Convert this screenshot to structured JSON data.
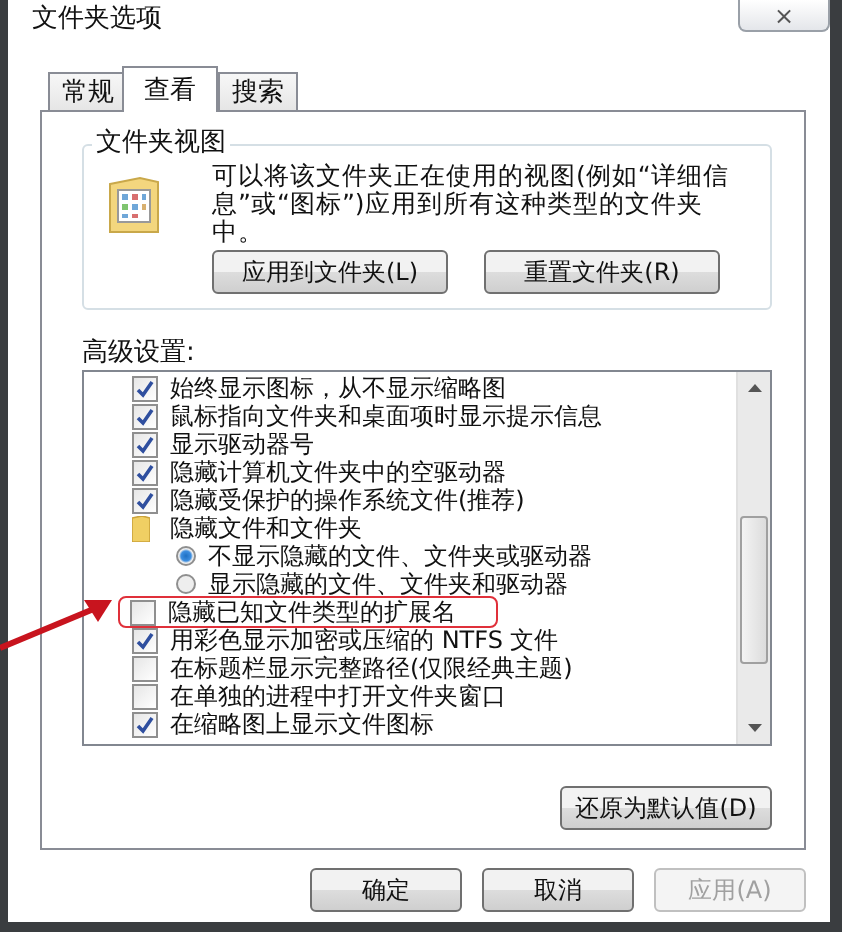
{
  "window": {
    "title": "文件夹选项",
    "close": "×"
  },
  "tabs": [
    {
      "label": "常规",
      "selected": false
    },
    {
      "label": "查看",
      "selected": true
    },
    {
      "label": "搜索",
      "selected": false
    }
  ],
  "folder_views": {
    "title": "文件夹视图",
    "description": "可以将该文件夹正在使用的视图(例如“详细信息”或“图标”)应用到所有这种类型的文件夹中。",
    "buttons": [
      {
        "label": "应用到文件夹(L)",
        "disabled": false
      },
      {
        "label": "重置文件夹(R)",
        "disabled": false
      }
    ]
  },
  "advanced": {
    "title": "高级设置:",
    "items": [
      {
        "kind": "checkbox",
        "label": "始终显示图标，从不显示缩略图",
        "checked": true,
        "highlighted": false
      },
      {
        "kind": "checkbox",
        "label": "鼠标指向文件夹和桌面项时显示提示信息",
        "checked": true,
        "highlighted": false
      },
      {
        "kind": "checkbox",
        "label": "显示驱动器号",
        "checked": true,
        "highlighted": false
      },
      {
        "kind": "checkbox",
        "label": "隐藏计算机文件夹中的空驱动器",
        "checked": true,
        "highlighted": false
      },
      {
        "kind": "checkbox",
        "label": "隐藏受保护的操作系统文件(推荐)",
        "checked": true,
        "highlighted": false
      },
      {
        "kind": "folder",
        "label": "隐藏文件和文件夹",
        "highlighted": false,
        "children": [
          {
            "kind": "radio",
            "label": "不显示隐藏的文件、文件夹或驱动器",
            "selected": true,
            "highlighted": false
          },
          {
            "kind": "radio",
            "label": "显示隐藏的文件、文件夹和驱动器",
            "selected": false,
            "highlighted": false
          }
        ]
      },
      {
        "kind": "checkbox",
        "label": "隐藏已知文件类型的扩展名",
        "checked": false,
        "highlighted": true
      },
      {
        "kind": "checkbox",
        "label": "用彩色显示加密或压缩的 NTFS 文件",
        "checked": true,
        "highlighted": false
      },
      {
        "kind": "checkbox",
        "label": "在标题栏显示完整路径(仅限经典主题)",
        "checked": false,
        "highlighted": false
      },
      {
        "kind": "checkbox",
        "label": "在单独的进程中打开文件夹窗口",
        "checked": false,
        "highlighted": false
      },
      {
        "kind": "checkbox",
        "label": "在缩略图上显示文件图标",
        "checked": true,
        "highlighted": false
      }
    ],
    "restore_button": {
      "label": "还原为默认值(D)",
      "disabled": false
    }
  },
  "buttons": [
    {
      "label": "确定",
      "disabled": false
    },
    {
      "label": "取消",
      "disabled": false
    },
    {
      "label": "应用(A)",
      "disabled": true
    }
  ]
}
